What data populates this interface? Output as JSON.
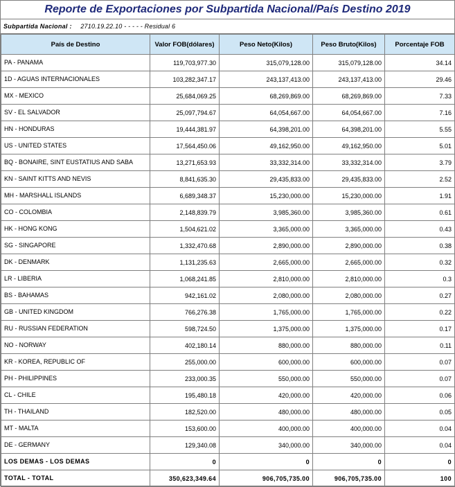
{
  "report": {
    "title": "Reporte de Exportaciones por Subpartida Nacional/País Destino 2019",
    "subpartida_label": "Subpartida Nacional :",
    "subpartida_value": "2710.19.22.10 - - - - - Residual 6"
  },
  "table": {
    "headers": [
      "País de Destino",
      "Valor FOB(dólares)",
      "Peso Neto(Kilos)",
      "Peso Bruto(Kilos)",
      "Porcentaje FOB"
    ],
    "rows": [
      [
        "PA - PANAMA",
        "119,703,977.30",
        "315,079,128.00",
        "315,079,128.00",
        "34.14"
      ],
      [
        "1D - AGUAS INTERNACIONALES",
        "103,282,347.17",
        "243,137,413.00",
        "243,137,413.00",
        "29.46"
      ],
      [
        "MX - MEXICO",
        "25,684,069.25",
        "68,269,869.00",
        "68,269,869.00",
        "7.33"
      ],
      [
        "SV - EL SALVADOR",
        "25,097,794.67",
        "64,054,667.00",
        "64,054,667.00",
        "7.16"
      ],
      [
        "HN - HONDURAS",
        "19,444,381.97",
        "64,398,201.00",
        "64,398,201.00",
        "5.55"
      ],
      [
        "US - UNITED STATES",
        "17,564,450.06",
        "49,162,950.00",
        "49,162,950.00",
        "5.01"
      ],
      [
        "BQ - BONAIRE, SINT EUSTATIUS AND SABA",
        "13,271,653.93",
        "33,332,314.00",
        "33,332,314.00",
        "3.79"
      ],
      [
        "KN - SAINT KITTS AND NEVIS",
        "8,841,635.30",
        "29,435,833.00",
        "29,435,833.00",
        "2.52"
      ],
      [
        "MH - MARSHALL ISLANDS",
        "6,689,348.37",
        "15,230,000.00",
        "15,230,000.00",
        "1.91"
      ],
      [
        "CO - COLOMBIA",
        "2,148,839.79",
        "3,985,360.00",
        "3,985,360.00",
        "0.61"
      ],
      [
        "HK - HONG KONG",
        "1,504,621.02",
        "3,365,000.00",
        "3,365,000.00",
        "0.43"
      ],
      [
        "SG - SINGAPORE",
        "1,332,470.68",
        "2,890,000.00",
        "2,890,000.00",
        "0.38"
      ],
      [
        "DK - DENMARK",
        "1,131,235.63",
        "2,665,000.00",
        "2,665,000.00",
        "0.32"
      ],
      [
        "LR - LIBERIA",
        "1,068,241.85",
        "2,810,000.00",
        "2,810,000.00",
        "0.3"
      ],
      [
        "BS - BAHAMAS",
        "942,161.02",
        "2,080,000.00",
        "2,080,000.00",
        "0.27"
      ],
      [
        "GB - UNITED KINGDOM",
        "766,276.38",
        "1,765,000.00",
        "1,765,000.00",
        "0.22"
      ],
      [
        "RU - RUSSIAN FEDERATION",
        "598,724.50",
        "1,375,000.00",
        "1,375,000.00",
        "0.17"
      ],
      [
        "NO - NORWAY",
        "402,180.14",
        "880,000.00",
        "880,000.00",
        "0.11"
      ],
      [
        "KR - KOREA, REPUBLIC OF",
        "255,000.00",
        "600,000.00",
        "600,000.00",
        "0.07"
      ],
      [
        "PH - PHILIPPINES",
        "233,000.35",
        "550,000.00",
        "550,000.00",
        "0.07"
      ],
      [
        "CL - CHILE",
        "195,480.18",
        "420,000.00",
        "420,000.00",
        "0.06"
      ],
      [
        "TH - THAILAND",
        "182,520.00",
        "480,000.00",
        "480,000.00",
        "0.05"
      ],
      [
        "MT - MALTA",
        "153,600.00",
        "400,000.00",
        "400,000.00",
        "0.04"
      ],
      [
        "DE - GERMANY",
        "129,340.08",
        "340,000.00",
        "340,000.00",
        "0.04"
      ]
    ],
    "others": [
      "LOS DEMAS - LOS DEMAS",
      "0",
      "0",
      "0",
      "0"
    ],
    "total": [
      "TOTAL - TOTAL",
      "350,623,349.64",
      "906,705,735.00",
      "906,705,735.00",
      "100"
    ]
  }
}
